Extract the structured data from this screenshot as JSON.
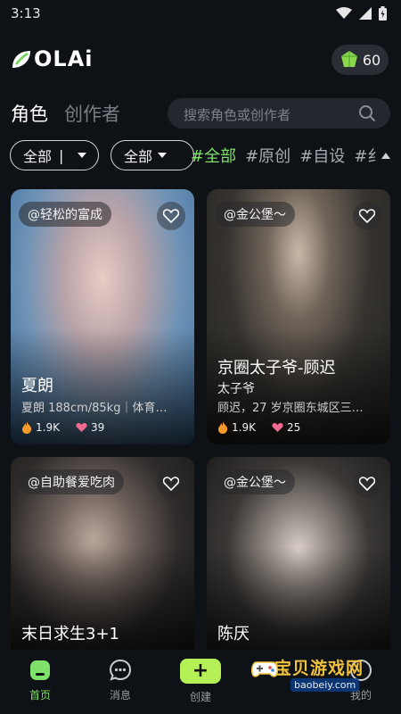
{
  "status": {
    "time": "3:13"
  },
  "header": {
    "logo_text": "OLAi",
    "gems": "60"
  },
  "tabs": {
    "main": "角色",
    "secondary": "创作者"
  },
  "search": {
    "placeholder": "搜索角色或创作者"
  },
  "filters": {
    "dropdown1": "全部",
    "dropdown1_sep": "|",
    "dropdown2": "全部",
    "tags": [
      "#全部",
      "#原创",
      "#自设",
      "#纟"
    ]
  },
  "cards": [
    {
      "creator": "@轻松的富成",
      "name": "夏朗",
      "tag": "",
      "desc": "夏朗 188cm/85kg｜体育…",
      "views": "1.9K",
      "likes": "39"
    },
    {
      "creator": "@金公堡～",
      "name": "京圈太子爷-顾迟",
      "tag": "太子爷",
      "desc": "顾迟，27 岁京圈东城区三…",
      "views": "1.9K",
      "likes": "25"
    },
    {
      "creator": "@自助餐爱吃肉",
      "name": "末日求生3+1",
      "tag": "",
      "desc": "",
      "views": "",
      "likes": ""
    },
    {
      "creator": "@金公堡～",
      "name": "陈厌",
      "tag": "",
      "desc": "",
      "views": "",
      "likes": ""
    }
  ],
  "nav": [
    {
      "label": "首页"
    },
    {
      "label": "消息"
    },
    {
      "label": "创建"
    },
    {
      "label": "我的"
    }
  ],
  "watermark": {
    "title": "宝贝游戏网",
    "url": "baobeiy.com"
  },
  "colors": {
    "accent": "#7fe06a",
    "create": "#b5f056",
    "background": "#0e1116"
  }
}
